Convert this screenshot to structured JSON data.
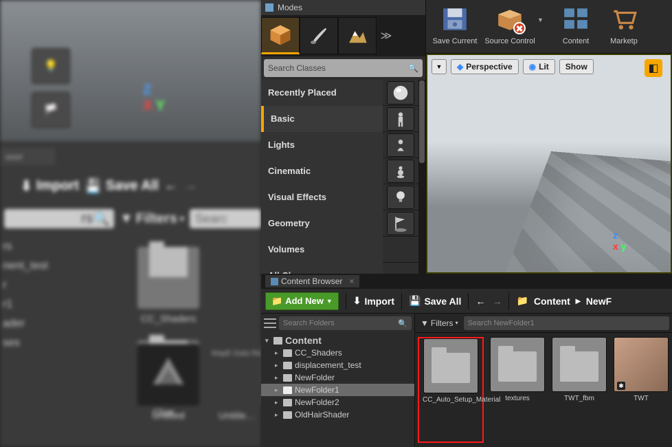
{
  "left": {
    "tab": "wser",
    "import": "Import",
    "save_all": "Save All",
    "folders_search": "rs",
    "filters": "Filters",
    "search": "Searc",
    "tree": [
      "rs",
      "",
      "nent_test",
      "r",
      "r1",
      "ader",
      "ses"
    ],
    "items": [
      {
        "label": "CC_Shaders"
      },
      {
        "label": "Char…"
      },
      {
        "label": "Untitled"
      },
      {
        "label": "Untitle…"
      }
    ],
    "map_badge": "MapE\nData Re"
  },
  "modes": {
    "title": "Modes",
    "search_placeholder": "Search Classes",
    "categories": [
      {
        "label": "Recently Placed"
      },
      {
        "label": "Basic",
        "selected": true
      },
      {
        "label": "Lights"
      },
      {
        "label": "Cinematic"
      },
      {
        "label": "Visual Effects"
      },
      {
        "label": "Geometry"
      },
      {
        "label": "Volumes"
      },
      {
        "label": "All Classes"
      }
    ]
  },
  "toolbar": {
    "save_current": "Save Current",
    "source_control": "Source Control",
    "content": "Content",
    "marketplace": "Marketp"
  },
  "viewport": {
    "perspective": "Perspective",
    "lit": "Lit",
    "show": "Show"
  },
  "content_browser": {
    "tab": "Content Browser",
    "add_new": "Add New",
    "import": "Import",
    "save_all": "Save All",
    "breadcrumb_root": "Content",
    "breadcrumb_leaf": "NewF",
    "search_folders_placeholder": "Search Folders",
    "filters": "Filters",
    "search_assets_placeholder": "Search NewFolder1",
    "tree": {
      "root": "Content",
      "children": [
        "CC_Shaders",
        "displacement_test",
        "NewFolder",
        "NewFolder1",
        "NewFolder2",
        "OldHairShader"
      ],
      "selected": "NewFolder1"
    },
    "assets": [
      {
        "name": "CC_Auto_Setup_Material",
        "type": "folder",
        "highlight": true
      },
      {
        "name": "textures",
        "type": "folder"
      },
      {
        "name": "TWT_fbm",
        "type": "folder"
      },
      {
        "name": "TWT",
        "type": "texture"
      }
    ]
  }
}
